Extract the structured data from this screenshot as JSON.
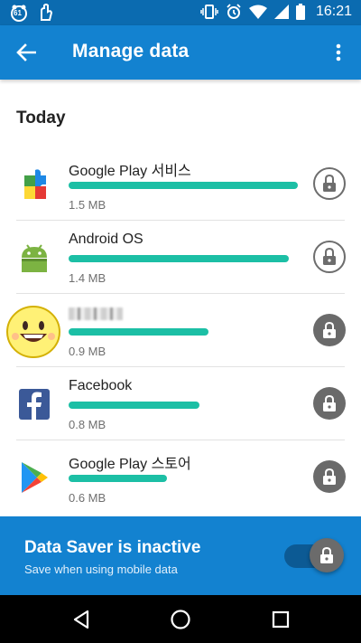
{
  "status_bar": {
    "time": "16:21",
    "left_icons": [
      "notification-badge-icon",
      "download-hand-icon"
    ],
    "right_icons": [
      "vibrate-icon",
      "alarm-icon",
      "wifi-icon",
      "signal-icon",
      "battery-icon"
    ],
    "badge_text": "61"
  },
  "app_bar": {
    "title": "Manage data",
    "back_icon": "arrow-back-icon",
    "menu_icon": "more-vert-icon",
    "color": "#1382d0"
  },
  "section": {
    "title": "Today"
  },
  "apps": [
    {
      "name": "Google Play 서비스",
      "size": "1.5 MB",
      "usage": 1.0,
      "icon": "google-play-services-icon",
      "locked": false
    },
    {
      "name": "Android OS",
      "size": "1.4 MB",
      "usage": 0.96,
      "icon": "android-icon",
      "locked": false
    },
    {
      "name": "",
      "size": "0.9 MB",
      "usage": 0.61,
      "icon": "smiley-app-icon",
      "locked": true,
      "name_obscured": true
    },
    {
      "name": "Facebook",
      "size": "0.8 MB",
      "usage": 0.57,
      "icon": "facebook-icon",
      "locked": true
    },
    {
      "name": "Google Play 스토어",
      "size": "0.6 MB",
      "usage": 0.43,
      "icon": "google-play-store-icon",
      "locked": true
    }
  ],
  "data_saver": {
    "title": "Data Saver is inactive",
    "subtitle": "Save when using mobile data",
    "toggle_on": true
  },
  "nav_bar": {
    "buttons": [
      "back-nav-icon",
      "home-nav-icon",
      "recents-nav-icon"
    ]
  },
  "colors": {
    "accent": "#1cbfa5",
    "primary": "#1382d0",
    "primary_dark": "#0b6bb0"
  }
}
